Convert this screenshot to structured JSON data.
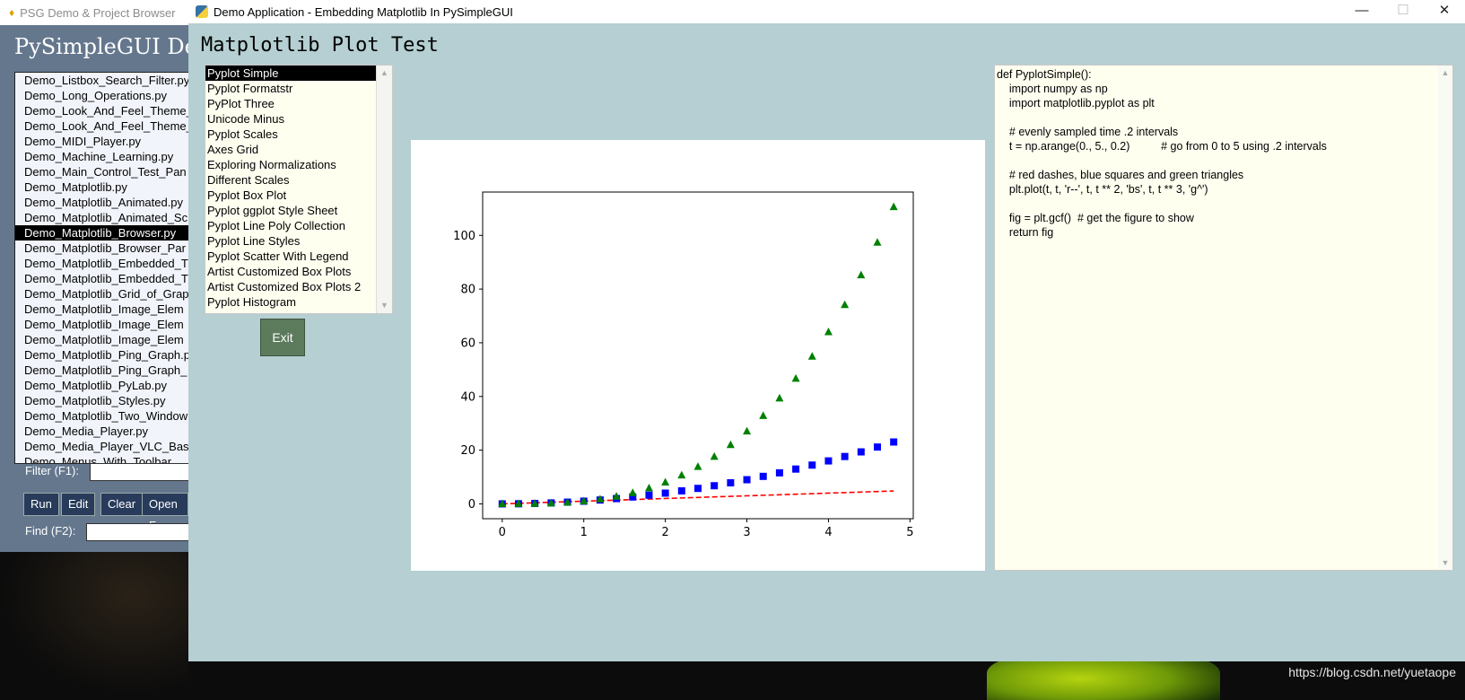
{
  "background": {
    "watermark": "https://blog.csdn.net/yuetaope"
  },
  "back_window": {
    "title": "PSG Demo & Project Browser",
    "heading": "PySimpleGUI De",
    "files": [
      "Demo_Listbox_Search_Filter.py",
      "Demo_Long_Operations.py",
      "Demo_Look_And_Feel_Theme_",
      "Demo_Look_And_Feel_Theme_",
      "Demo_MIDI_Player.py",
      "Demo_Machine_Learning.py",
      "Demo_Main_Control_Test_Pan",
      "Demo_Matplotlib.py",
      "Demo_Matplotlib_Animated.py",
      "Demo_Matplotlib_Animated_Sc",
      "Demo_Matplotlib_Browser.py",
      "Demo_Matplotlib_Browser_Par",
      "Demo_Matplotlib_Embedded_T",
      "Demo_Matplotlib_Embedded_T",
      "Demo_Matplotlib_Grid_of_Grap",
      "Demo_Matplotlib_Image_Elem",
      "Demo_Matplotlib_Image_Elem",
      "Demo_Matplotlib_Image_Elem",
      "Demo_Matplotlib_Ping_Graph.p",
      "Demo_Matplotlib_Ping_Graph_",
      "Demo_Matplotlib_PyLab.py",
      "Demo_Matplotlib_Styles.py",
      "Demo_Matplotlib_Two_Window",
      "Demo_Media_Player.py",
      "Demo_Media_Player_VLC_Bas",
      "Demo_Menus_With_Toolbar"
    ],
    "selected_file": "Demo_Matplotlib_Browser.py",
    "filter_label": "Filter (F1):",
    "find_label": "Find (F2):",
    "buttons": {
      "run": "Run",
      "edit": "Edit",
      "clear": "Clear",
      "open": "Open F"
    }
  },
  "window": {
    "title": "Demo Application - Embedding Matplotlib In PySimpleGUI",
    "minimize": "—",
    "maximize": "☐",
    "close": "✕",
    "heading": "Matplotlib Plot Test",
    "listbox_items": [
      "Pyplot Simple",
      "Pyplot Formatstr",
      "PyPlot Three",
      "Unicode Minus",
      "Pyplot Scales",
      "Axes Grid",
      "Exploring Normalizations",
      "Different Scales",
      "Pyplot Box Plot",
      "Pyplot ggplot Style Sheet",
      "Pyplot Line Poly Collection",
      "Pyplot Line Styles",
      "Pyplot Scatter With Legend",
      "Artist Customized Box Plots",
      "Artist Customized Box Plots 2",
      "Pyplot Histogram"
    ],
    "selected_item": "Pyplot Simple",
    "exit_label": "Exit",
    "code_lines": [
      "def PyplotSimple():",
      "    import numpy as np",
      "    import matplotlib.pyplot as plt",
      "",
      "    # evenly sampled time .2 intervals",
      "    t = np.arange(0., 5., 0.2)          # go from 0 to 5 using .2 intervals",
      "",
      "    # red dashes, blue squares and green triangles",
      "    plt.plot(t, t, 'r--', t, t ** 2, 'bs', t, t ** 3, 'g^')",
      "",
      "    fig = plt.gcf()  # get the figure to show",
      "    return fig"
    ]
  },
  "chart_data": {
    "type": "line",
    "x": [
      0.0,
      0.2,
      0.4,
      0.6,
      0.8,
      1.0,
      1.2,
      1.4,
      1.6,
      1.8,
      2.0,
      2.2,
      2.4,
      2.6,
      2.8,
      3.0,
      3.2,
      3.4,
      3.6,
      3.8,
      4.0,
      4.2,
      4.4,
      4.6,
      4.8
    ],
    "series": [
      {
        "style": "r--",
        "color": "#ff0000",
        "values": [
          0.0,
          0.2,
          0.4,
          0.6,
          0.8,
          1.0,
          1.2,
          1.4,
          1.6,
          1.8,
          2.0,
          2.2,
          2.4,
          2.6,
          2.8,
          3.0,
          3.2,
          3.4,
          3.6,
          3.8,
          4.0,
          4.2,
          4.4,
          4.6,
          4.8
        ]
      },
      {
        "style": "bs",
        "color": "#0000ff",
        "values": [
          0.0,
          0.04,
          0.16,
          0.36,
          0.64,
          1.0,
          1.44,
          1.96,
          2.56,
          3.24,
          4.0,
          4.84,
          5.76,
          6.76,
          7.84,
          9.0,
          10.24,
          11.56,
          12.96,
          14.44,
          16.0,
          17.64,
          19.36,
          21.16,
          23.04
        ]
      },
      {
        "style": "g^",
        "color": "#008000",
        "values": [
          0.0,
          0.008,
          0.064,
          0.216,
          0.512,
          1.0,
          1.728,
          2.744,
          4.096,
          5.832,
          8.0,
          10.648,
          13.824,
          17.576,
          21.952,
          27.0,
          32.768,
          39.304,
          46.656,
          54.872,
          64.0,
          74.088,
          85.184,
          97.336,
          110.592
        ]
      }
    ],
    "xticks": [
      "0",
      "1",
      "2",
      "3",
      "4",
      "5"
    ],
    "yticks": [
      "0",
      "20",
      "40",
      "60",
      "80",
      "100"
    ],
    "xlim": [
      -0.24,
      5.04
    ],
    "ylim": [
      -5.53,
      116.13
    ],
    "grid": false
  }
}
